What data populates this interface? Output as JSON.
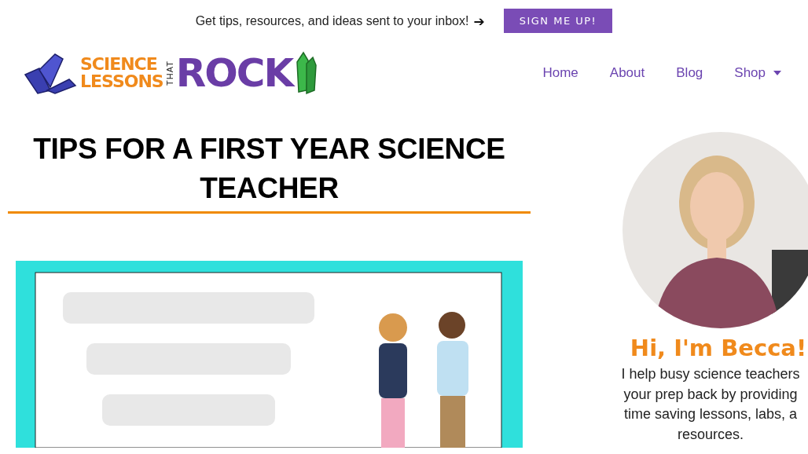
{
  "topbar": {
    "text": "Get tips, resources, and ideas sent to your inbox!",
    "arrow": "➔",
    "button": "SIGN ME UP!"
  },
  "logo": {
    "line1": "SCIENCE",
    "line2": "LESSONS",
    "small": "THAT",
    "big": "ROCK"
  },
  "nav": [
    {
      "label": "Home",
      "dropdown": false
    },
    {
      "label": "About",
      "dropdown": false
    },
    {
      "label": "Blog",
      "dropdown": false
    },
    {
      "label": "Shop",
      "dropdown": true
    }
  ],
  "post": {
    "title": "TIPS FOR A FIRST YEAR SCIENCE TEACHER"
  },
  "sidebar": {
    "greeting": "Hi, I'm Becca!",
    "lines": [
      "I help busy science teachers",
      "your prep back by providing",
      "time saving lessons, labs, a",
      "resources."
    ]
  }
}
